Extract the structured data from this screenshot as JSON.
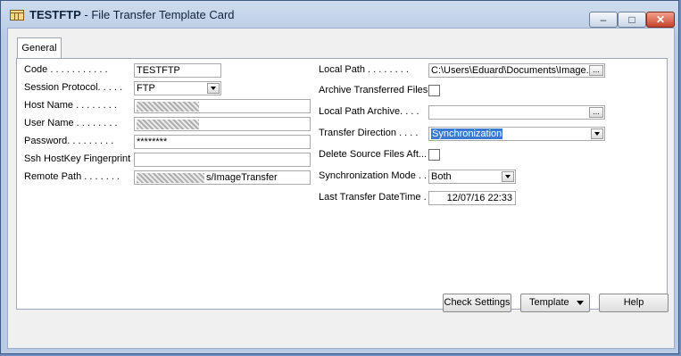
{
  "window": {
    "record": "TESTFTP",
    "separator": " - ",
    "title": "File Transfer Template Card",
    "minimize_glyph": "–",
    "maximize_glyph": "□",
    "close_glyph": "✕"
  },
  "tabs": [
    {
      "label": "General"
    }
  ],
  "left_fields": [
    {
      "label": "Code . . . . . . . . . . .",
      "value": "TESTFTP"
    },
    {
      "label": "Session Protocol. . . . .",
      "value": "FTP"
    },
    {
      "label": "Host Name . . . . . . . .",
      "value": ""
    },
    {
      "label": "User Name . . . . . . . .",
      "value": ""
    },
    {
      "label": "Password. . . . . . . . .",
      "value": "********"
    },
    {
      "label": "Ssh HostKey Fingerprint .",
      "value": ""
    },
    {
      "label": "Remote Path . . . . . . .",
      "value": "s/ImageTransfer"
    }
  ],
  "right_fields": [
    {
      "label": "Local Path . . . . . . . .",
      "value": "C:\\Users\\Eduard\\Documents\\Image..."
    },
    {
      "label": "Archive Transferred Files",
      "value": ""
    },
    {
      "label": "Local Path Archive. . . .",
      "value": ""
    },
    {
      "label": "Transfer Direction . . . .",
      "value": "Synchronization"
    },
    {
      "label": "Delete Source Files Aft...",
      "value": ""
    },
    {
      "label": "Synchronization Mode . .",
      "value": "Both"
    },
    {
      "label": "Last Transfer DateTime .",
      "value": "12/07/16 22:33"
    }
  ],
  "buttons": {
    "check_settings": "Check Settings",
    "template": "Template",
    "help": "Help"
  },
  "icons": {
    "app": "table-icon",
    "lookup": "ellipsis-icon",
    "dropdown": "chevron-down-icon"
  }
}
